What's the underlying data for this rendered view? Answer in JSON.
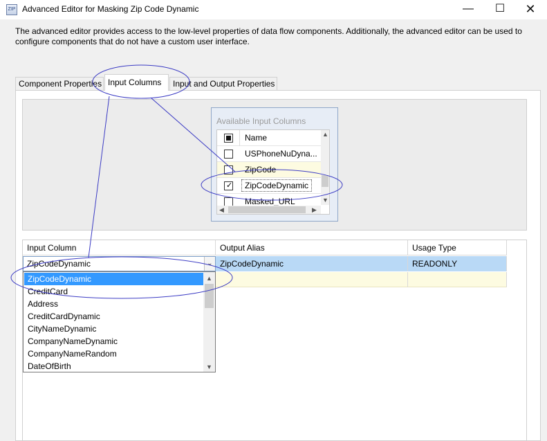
{
  "window": {
    "title": "Advanced Editor for Masking Zip Code Dynamic",
    "app_icon": "ssis-icon"
  },
  "description": "The advanced editor provides access to the low-level properties of data flow components. Additionally, the advanced editor can be used to configure components that do not have a custom user interface.",
  "tabs": [
    {
      "label": "Component Properties",
      "active": false
    },
    {
      "label": "Input Columns",
      "active": true
    },
    {
      "label": "Input and Output Properties",
      "active": false
    }
  ],
  "available_columns": {
    "title": "Available Input Columns",
    "header_label": "Name",
    "items": [
      {
        "label": "USPhoneNuDyna...",
        "checked": false
      },
      {
        "label": "ZipCode",
        "checked": false
      },
      {
        "label": "ZipCodeDynamic",
        "checked": true
      },
      {
        "label": "Masked_URL",
        "checked": false
      }
    ]
  },
  "grid": {
    "headers": {
      "input": "Input Column",
      "alias": "Output Alias",
      "usage": "Usage Type"
    },
    "rows": [
      {
        "input": "ZipCodeDynamic",
        "alias": "ZipCodeDynamic",
        "usage": "READONLY"
      }
    ]
  },
  "dropdown": {
    "selected": "ZipCodeDynamic",
    "options": [
      "ZipCodeDynamic",
      "CreditCard",
      "Address",
      "CreditCardDynamic",
      "CityNameDynamic",
      "CompanyNameDynamic",
      "CompanyNameRandom",
      "DateOfBirth"
    ]
  },
  "colors": {
    "selection_blue": "#3399ff",
    "row_highlight": "#b9d9f6",
    "new_row": "#fdfbe1",
    "annotation": "#3b3bc4"
  }
}
